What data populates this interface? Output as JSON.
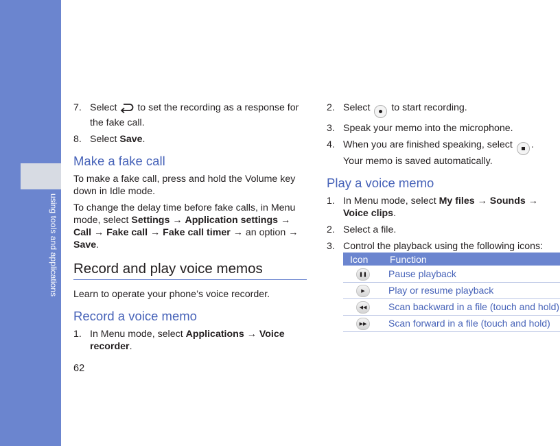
{
  "sidebar": {
    "label": "using tools and applications",
    "accent_color": "#6b85cf"
  },
  "page_number": "62",
  "left": {
    "steps_top": [
      {
        "num": "7.",
        "before": "Select",
        "icon": "back-arrow-icon",
        "after": "to set the recording as a response for the fake call."
      },
      {
        "num": "8.",
        "before": "Select",
        "bold": "Save",
        "after": "."
      }
    ],
    "fake_call": {
      "heading": "Make a fake call",
      "para1": "To make a fake call, press and hold the Volume key down in Idle mode.",
      "para2_before": "To change the delay time before fake calls, in Menu mode, select",
      "path": [
        "Settings",
        "Application settings",
        "Call",
        "Fake call",
        "Fake call timer"
      ],
      "para2_mid": "an option",
      "para2_end_bold": "Save",
      "para2_end": "."
    },
    "voice_memos": {
      "heading": "Record and play voice memos",
      "intro": "Learn to operate your phone’s voice recorder.",
      "record_heading": "Record a voice memo",
      "step1_num": "1.",
      "step1_before": "In Menu mode, select",
      "step1_path": [
        "Applications",
        "Voice recorder"
      ],
      "step1_end": "."
    }
  },
  "right": {
    "steps_top": [
      {
        "num": "2.",
        "before": "Select",
        "icon": "record-dot-icon",
        "after": "to start recording."
      },
      {
        "num": "3.",
        "text": "Speak your memo into the microphone."
      },
      {
        "num": "4.",
        "before": "When you are finished speaking, select",
        "icon": "stop-square-icon",
        "after": ".",
        "line2": "Your memo is saved automatically."
      }
    ],
    "play": {
      "heading": "Play a voice memo",
      "step1_num": "1.",
      "step1_before": "In Menu mode, select",
      "step1_path": [
        "My files",
        "Sounds",
        "Voice clips"
      ],
      "step1_end": ".",
      "step2_num": "2.",
      "step2": "Select a file.",
      "step3_num": "3.",
      "step3": "Control the playback using the following icons:"
    },
    "table": {
      "header_icon": "Icon",
      "header_function": "Function",
      "rows": [
        {
          "icon": "pause-icon",
          "glyph": "❚❚",
          "function": "Pause playback"
        },
        {
          "icon": "play-icon",
          "glyph": "▶",
          "function": "Play or resume playback"
        },
        {
          "icon": "rewind-icon",
          "glyph": "◀◀",
          "function": "Scan backward in a file (touch and hold)"
        },
        {
          "icon": "fast-forward-icon",
          "glyph": "▶▶",
          "function": "Scan forward in a file (touch and hold)"
        }
      ]
    }
  },
  "arrow": "→"
}
